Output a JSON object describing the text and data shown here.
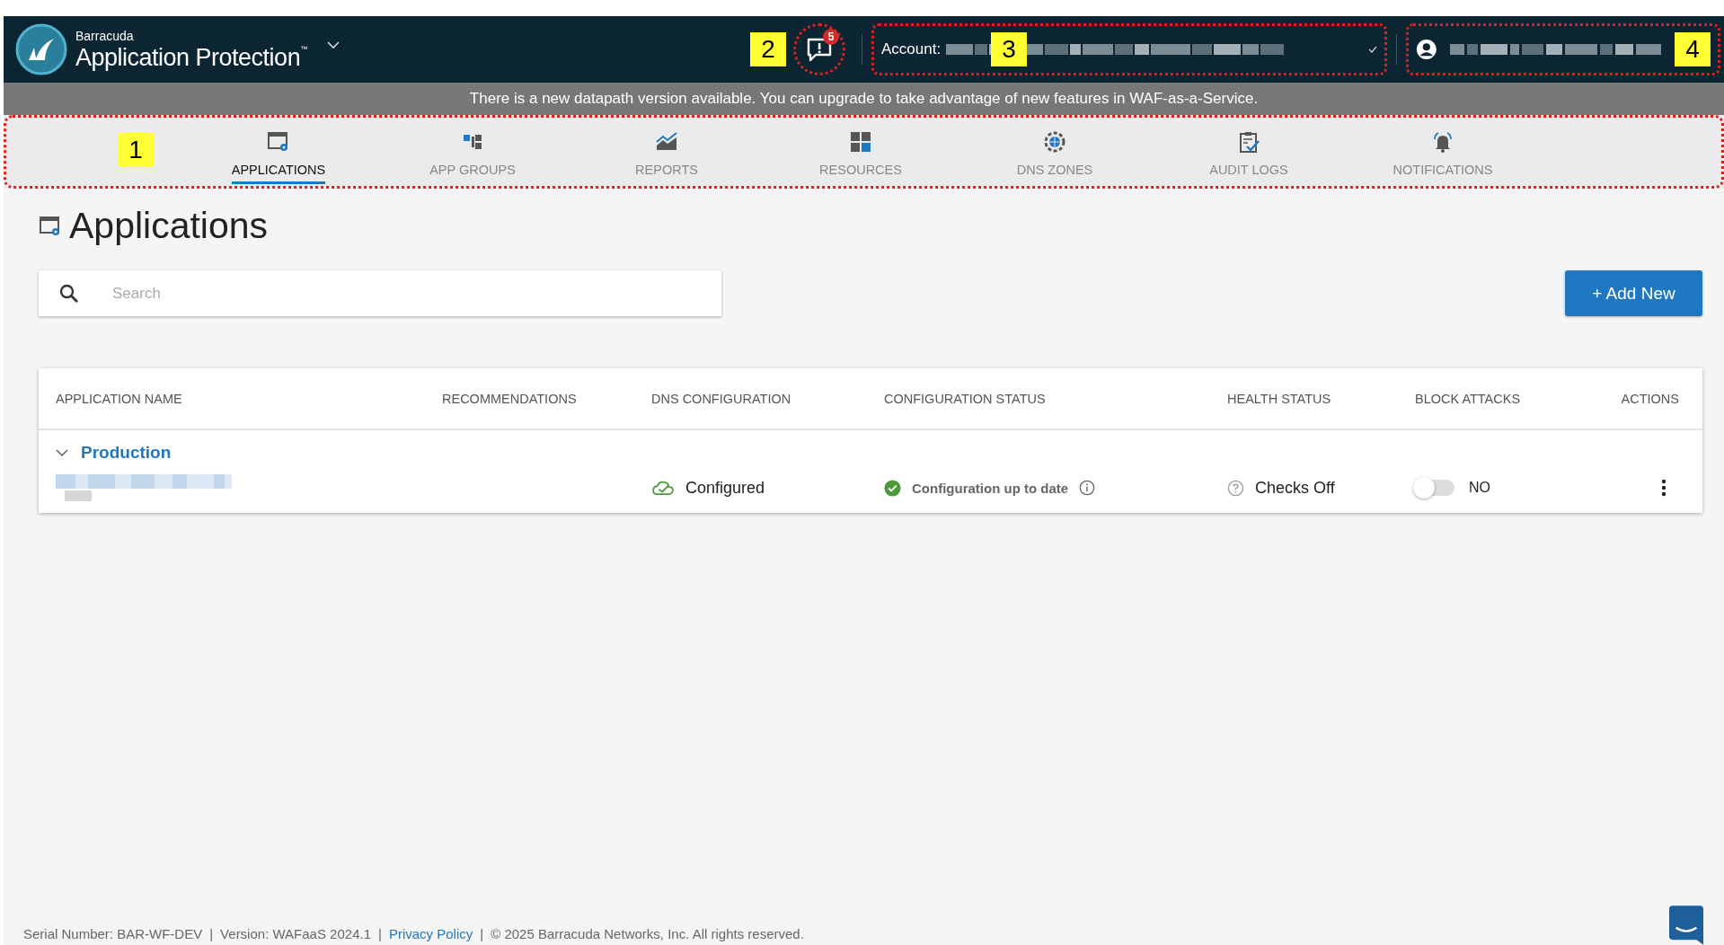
{
  "header": {
    "brand_small": "Barracuda",
    "brand_name": "Application Protection",
    "trademark": "™",
    "alert_count": "5",
    "account_label": "Account:"
  },
  "callouts": [
    "1",
    "2",
    "3",
    "4"
  ],
  "banner": "There is a new datapath version available. You can upgrade to take advantage of new features in WAF-as-a-Service.",
  "nav": [
    {
      "label": "APPLICATIONS",
      "selected": true
    },
    {
      "label": "APP GROUPS",
      "selected": false
    },
    {
      "label": "REPORTS",
      "selected": false
    },
    {
      "label": "RESOURCES",
      "selected": false
    },
    {
      "label": "DNS ZONES",
      "selected": false
    },
    {
      "label": "AUDIT LOGS",
      "selected": false
    },
    {
      "label": "NOTIFICATIONS",
      "selected": false
    }
  ],
  "page_title": "Applications",
  "search": {
    "placeholder": "Search"
  },
  "add_button": "+ Add New",
  "table": {
    "columns": [
      "APPLICATION NAME",
      "RECOMMENDATIONS",
      "DNS CONFIGURATION",
      "CONFIGURATION STATUS",
      "HEALTH STATUS",
      "BLOCK ATTACKS",
      "ACTIONS"
    ],
    "groups": [
      {
        "name": "Production",
        "expanded": true,
        "rows": [
          {
            "dns": "Configured",
            "config_status": "Configuration up to date",
            "health": "Checks Off",
            "block_attacks": {
              "on": false,
              "label": "NO"
            }
          }
        ]
      }
    ]
  },
  "footer": [
    {
      "kind": "text",
      "text": "Serial Number: BAR-WF-DEV"
    },
    {
      "kind": "sep",
      "text": "|"
    },
    {
      "kind": "text",
      "text": "Version: WAFaaS 2024.1"
    },
    {
      "kind": "sep",
      "text": "|"
    },
    {
      "kind": "link",
      "text": "Privacy Policy"
    },
    {
      "kind": "sep",
      "text": "|"
    },
    {
      "kind": "text",
      "text": "© 2025 Barracuda Networks, Inc. All rights reserved."
    }
  ]
}
